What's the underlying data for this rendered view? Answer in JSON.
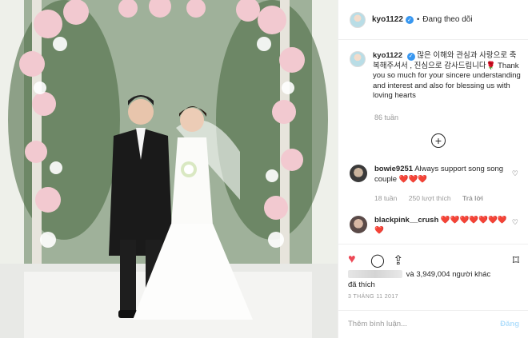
{
  "post": {
    "username": "kyo1122",
    "verified_icon": "✓",
    "follow_status": "Đang theo dõi",
    "caption": "많은 이해와 관심과 사랑으로 축복해주셔서 , 진심으로 감사드립니다🌹 Thank you so much for your sincere understanding and interest and also for blessing us with loving hearts",
    "caption_time": "86 tuần",
    "likes_count_text": "và 3,949,004 người khác",
    "likes_suffix": "đã thích",
    "date": "3 THÁNG 11 2017",
    "comment_placeholder": "Thêm bình luận...",
    "post_label": "Đăng"
  },
  "comments": [
    {
      "username": "bowie9251",
      "text": "Always support song song couple ❤️❤️❤️",
      "time": "18 tuần",
      "likes": "250 lượt thích",
      "reply": "Trả lời"
    },
    {
      "username": "blackpink__crush",
      "text": "❤️❤️❤️❤️❤️❤️❤️❤️"
    }
  ],
  "colors": {
    "accent_blue": "#3897f0",
    "like_red": "#ed4956",
    "muted": "#999999"
  }
}
